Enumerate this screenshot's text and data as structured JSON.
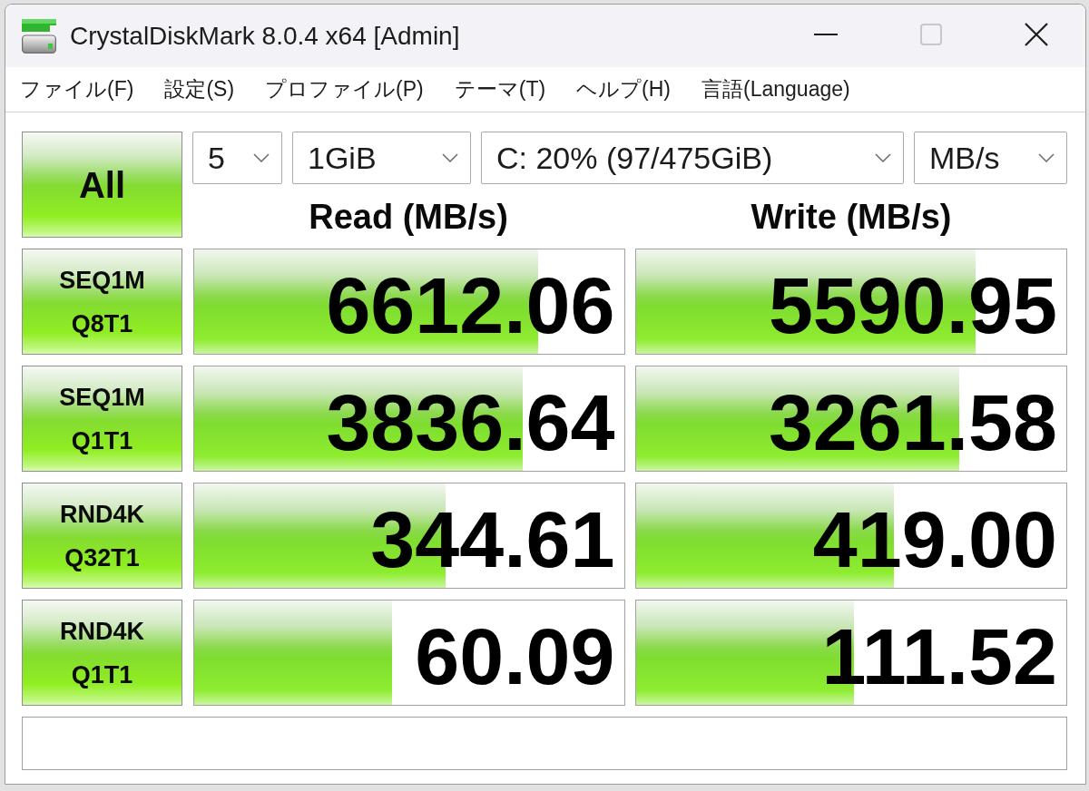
{
  "window": {
    "title": "CrystalDiskMark 8.0.4 x64 [Admin]",
    "buttons": [
      {
        "kind": "minimize",
        "disabled": false
      },
      {
        "kind": "maximize",
        "disabled": true
      },
      {
        "kind": "close",
        "disabled": false
      }
    ]
  },
  "menu": [
    {
      "label": "ファイル(F)"
    },
    {
      "label": "設定(S)"
    },
    {
      "label": "プロファイル(P)"
    },
    {
      "label": "テーマ(T)"
    },
    {
      "label": "ヘルプ(H)"
    },
    {
      "label": "言語(Language)"
    }
  ],
  "all_button": {
    "label": "All"
  },
  "dropdowns": [
    {
      "value": "5"
    },
    {
      "value": "1GiB"
    },
    {
      "value": "C: 20% (97/475GiB)"
    },
    {
      "value": "MB/s"
    }
  ],
  "columns": [
    "Read (MB/s)",
    "Write (MB/s)"
  ],
  "tests": [
    {
      "label": [
        "SEQ1M",
        "Q8T1"
      ],
      "read": {
        "value": "6612.06",
        "level": 0.8
      },
      "write": {
        "value": "5590.95",
        "level": 0.79
      }
    },
    {
      "label": [
        "SEQ1M",
        "Q1T1"
      ],
      "read": {
        "value": "3836.64",
        "level": 0.765
      },
      "write": {
        "value": "3261.58",
        "level": 0.75
      }
    },
    {
      "label": [
        "RND4K",
        "Q32T1"
      ],
      "read": {
        "value": "344.61",
        "level": 0.586
      },
      "write": {
        "value": "419.00",
        "level": 0.6
      }
    },
    {
      "label": [
        "RND4K",
        "Q1T1"
      ],
      "read": {
        "value": "60.09",
        "level": 0.46
      },
      "write": {
        "value": "111.52",
        "level": 0.506
      }
    }
  ]
}
